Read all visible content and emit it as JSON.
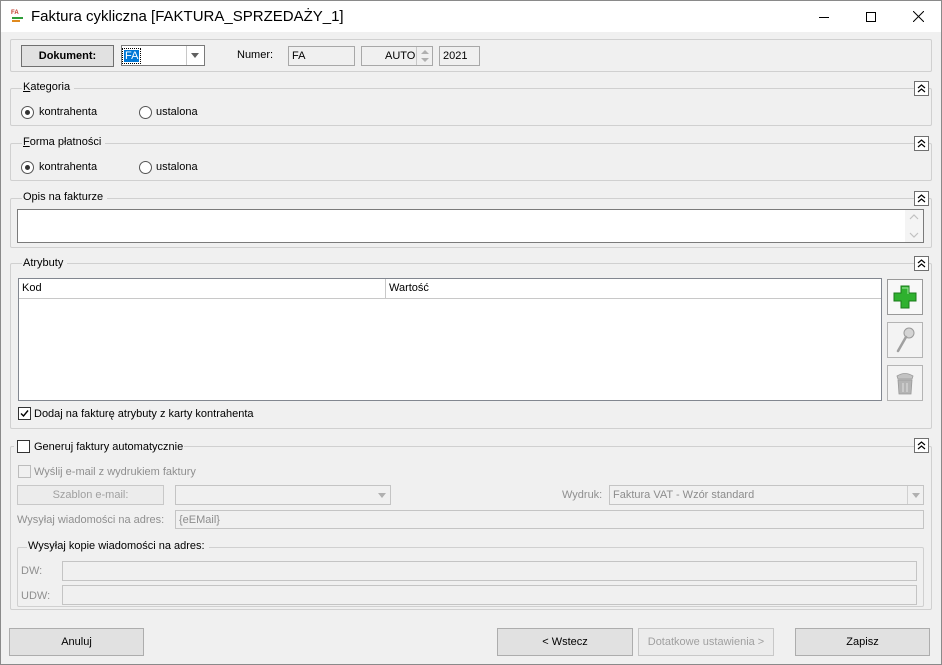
{
  "window": {
    "title": "Faktura cykliczna [FAKTURA_SPRZEDAŻY_1]",
    "icon_text": "FA",
    "icon": "invoice-app-icon",
    "controls": [
      "minimize-icon",
      "maximize-icon",
      "close-icon"
    ]
  },
  "document": {
    "button_label": "Dokument:",
    "type_value": "FA",
    "numer_label": "Numer:",
    "numer_prefix": "FA",
    "numer_auto": "AUTO",
    "numer_year": "2021"
  },
  "kategoria": {
    "label_first": "K",
    "label_rest": "ategoria",
    "options": [
      "kontrahenta",
      "ustalona"
    ],
    "selected": "kontrahenta"
  },
  "forma": {
    "label_first": "F",
    "label_rest": "orma płatności",
    "options": [
      "kontrahenta",
      "ustalona"
    ],
    "selected": "kontrahenta"
  },
  "opis": {
    "label": "Opis na fakturze",
    "value": ""
  },
  "atrybuty": {
    "label": "Atrybuty",
    "columns": [
      "Kod",
      "Wartość"
    ],
    "rows": [],
    "checkbox_label": "Dodaj na fakturę atrybuty z karty kontrahenta",
    "checkbox_checked": true,
    "side_buttons": [
      "add-icon",
      "edit-icon",
      "delete-icon"
    ]
  },
  "auto": {
    "checkbox_label": "Generuj faktury automatycznie",
    "checkbox_checked": false,
    "email_checkbox_label": "Wyślij e-mail z wydrukiem faktury",
    "szablon_button": "Szablon e-mail:",
    "szablon_value": "",
    "wydruk_label": "Wydruk:",
    "wydruk_value": "Faktura VAT - Wzór standard",
    "adres_label": "Wysyłaj wiadomości na adres:",
    "adres_value": "{eEMail}",
    "kopie_label": "Wysyłaj kopie wiadomości na adres:",
    "dw_label": "DW:",
    "dw_value": "",
    "udw_label": "UDW:",
    "udw_value": ""
  },
  "footer": {
    "cancel": "Anuluj",
    "back": "< Wstecz",
    "more": "Dotatkowe ustawienia >",
    "save": "Zapisz"
  },
  "colors": {
    "add_green": "#2fb12f",
    "focus_blue": "#0078d7",
    "disabled_text": "#8f8f8f"
  }
}
